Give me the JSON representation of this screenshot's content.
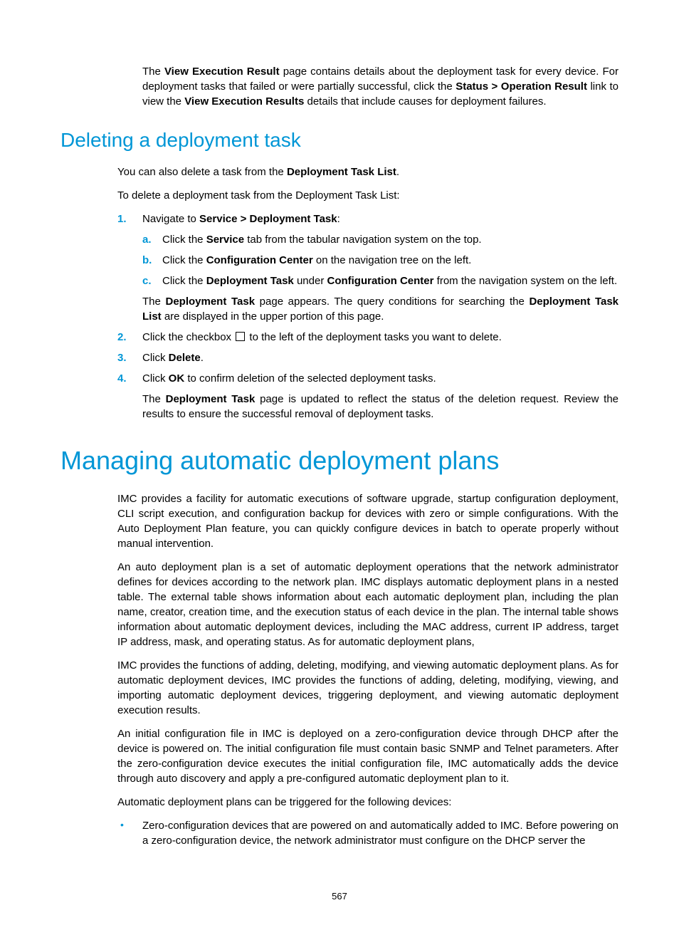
{
  "intro": {
    "seg1": "The ",
    "bold1": "View Execution Result",
    "seg2": " page contains details about the deployment task for every device. For deployment tasks that failed or were partially successful, click the ",
    "bold2": "Status > Operation Result",
    "seg3": " link to view the ",
    "bold3": "View Execution Results",
    "seg4": " details that include causes for deployment failures."
  },
  "h_delete": "Deleting a deployment task",
  "delete_p1": {
    "seg1": "You can also delete a task from the ",
    "bold1": "Deployment Task List",
    "seg2": "."
  },
  "delete_p2": "To delete a deployment task from the Deployment Task List:",
  "steps": [
    {
      "marker": "1.",
      "lead_seg1": "Navigate to ",
      "lead_bold": "Service > Deployment Task",
      "lead_seg2": ":",
      "subs": [
        {
          "m": "a.",
          "seg1": "Click the ",
          "b1": "Service",
          "seg2": " tab from the tabular navigation system on the top."
        },
        {
          "m": "b.",
          "seg1": "Click the ",
          "b1": "Configuration Center",
          "seg2": " on the navigation tree on the left."
        },
        {
          "m": "c.",
          "seg1": "Click the ",
          "b1": "Deployment Task",
          "seg2": " under ",
          "b2": "Configuration Center",
          "seg3": " from the navigation system on the left."
        }
      ],
      "after_seg1": "The ",
      "after_b1": "Deployment Task",
      "after_seg2": " page appears. The query conditions for searching the ",
      "after_b2": "Deployment Task List",
      "after_seg3": " are displayed in the upper portion of this page."
    },
    {
      "marker": "2.",
      "seg1": "Click the checkbox ",
      "seg2": " to the left of the deployment tasks you want to delete."
    },
    {
      "marker": "3.",
      "seg1": "Click ",
      "b1": "Delete",
      "seg2": "."
    },
    {
      "marker": "4.",
      "seg1": "Click ",
      "b1": "OK",
      "seg2": " to confirm deletion of the selected deployment tasks.",
      "after_seg1": "The ",
      "after_b1": "Deployment Task",
      "after_seg2": " page is updated to reflect the status of the deletion request. Review the results to ensure the successful removal of deployment tasks."
    }
  ],
  "h_manage": "Managing automatic deployment plans",
  "mp1": "IMC provides a facility for automatic executions of software upgrade, startup configuration deployment, CLI script execution, and configuration backup for devices with zero or simple configurations. With the Auto Deployment Plan feature, you can quickly configure devices in batch to operate properly without manual intervention.",
  "mp2": "An auto deployment plan is a set of automatic deployment operations that the network administrator defines for devices according to the network plan. IMC displays automatic deployment plans in a nested table. The external table shows information about each automatic deployment plan, including the plan name, creator, creation time, and the execution status of each device in the plan. The internal table shows information about automatic deployment devices, including the MAC address, current IP address, target IP address, mask, and operating status. As for automatic deployment plans,",
  "mp3": "IMC provides the functions of adding, deleting, modifying, and viewing automatic deployment plans. As for automatic deployment devices, IMC provides the functions of adding, deleting, modifying, viewing, and importing automatic deployment devices, triggering deployment, and viewing automatic deployment execution results.",
  "mp4": "An initial configuration file in IMC is deployed on a zero-configuration device through DHCP after the device is powered on. The initial configuration file must contain basic SNMP and Telnet parameters. After the zero-configuration device executes the initial configuration file, IMC automatically adds the device through auto discovery and apply a pre-configured automatic deployment plan to it.",
  "mp5": "Automatic deployment plans can be triggered for the following devices:",
  "bullet1": "Zero-configuration devices that are powered on and automatically added to IMC. Before powering on a zero-configuration device, the network administrator must configure on the DHCP server the",
  "pagenum": "567"
}
